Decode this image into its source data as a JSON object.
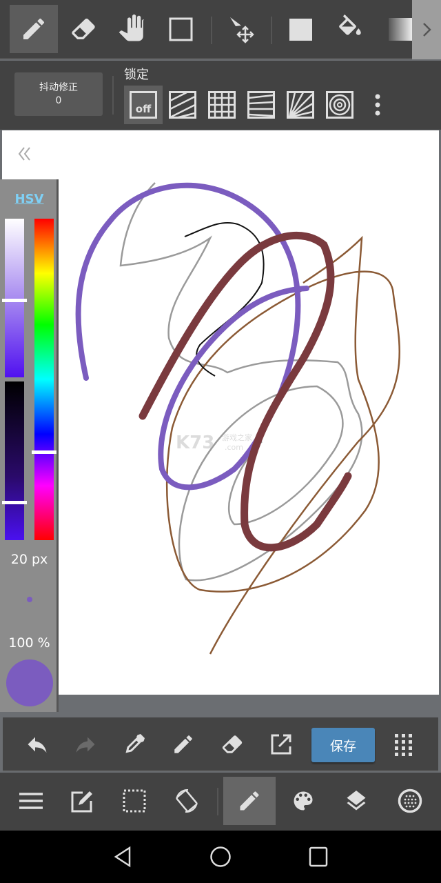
{
  "top_toolbar": {
    "tools": [
      {
        "icon": "pencil-icon",
        "selected": true
      },
      {
        "icon": "eraser-icon"
      },
      {
        "icon": "hand-icon"
      },
      {
        "icon": "rectangle-select-icon"
      },
      {
        "icon": "move-icon"
      },
      {
        "icon": "fill-square-icon"
      },
      {
        "icon": "bucket-icon"
      },
      {
        "icon": "gradient-icon"
      }
    ],
    "more_icon": "chevron-right-icon"
  },
  "snap_bar": {
    "stabilizer_label": "抖动修正",
    "stabilizer_value": "0",
    "lock_label": "锁定",
    "off_label": "off",
    "snaps": [
      "off",
      "parallel",
      "grid",
      "perspective",
      "radial",
      "concentric"
    ]
  },
  "color_panel": {
    "mode_label": "HSV",
    "brush_size": "20 px",
    "opacity": "100 %",
    "current_color": "#7b5cbf",
    "hue_level": 0.74,
    "saturation_level": 0.51,
    "value_level": 0.76
  },
  "canvas": {
    "watermark": "K73 游戏之家 .com"
  },
  "action_bar": {
    "save_label": "保存"
  },
  "colors": {
    "accent": "#4a86b8",
    "toolbar": "#424242"
  }
}
